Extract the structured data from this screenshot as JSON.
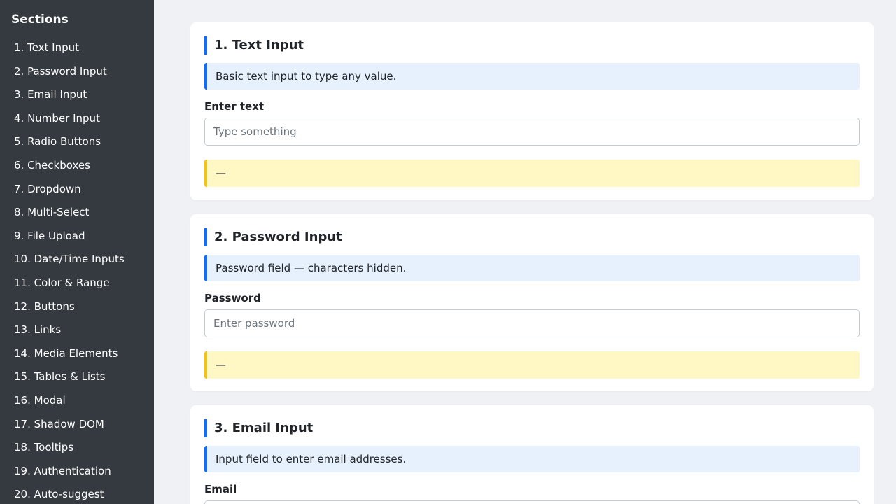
{
  "sidebar": {
    "title": "Sections",
    "items": [
      {
        "label": "1. Text Input"
      },
      {
        "label": "2. Password Input"
      },
      {
        "label": "3. Email Input"
      },
      {
        "label": "4. Number Input"
      },
      {
        "label": "5. Radio Buttons"
      },
      {
        "label": "6. Checkboxes"
      },
      {
        "label": "7. Dropdown"
      },
      {
        "label": "8. Multi-Select"
      },
      {
        "label": "9. File Upload"
      },
      {
        "label": "10. Date/Time Inputs"
      },
      {
        "label": "11. Color & Range"
      },
      {
        "label": "12. Buttons"
      },
      {
        "label": "13. Links"
      },
      {
        "label": "14. Media Elements"
      },
      {
        "label": "15. Tables & Lists"
      },
      {
        "label": "16. Modal"
      },
      {
        "label": "17. Shadow DOM"
      },
      {
        "label": "18. Tooltips"
      },
      {
        "label": "19. Authentication"
      },
      {
        "label": "20. Auto-suggest"
      }
    ]
  },
  "sections": {
    "text_input": {
      "title": "1. Text Input",
      "description": "Basic text input to type any value.",
      "label": "Enter text",
      "placeholder": "Type something",
      "value": "",
      "output": "—"
    },
    "password_input": {
      "title": "2. Password Input",
      "description": "Password field — characters hidden.",
      "label": "Password",
      "placeholder": "Enter password",
      "value": "",
      "output": "—"
    },
    "email_input": {
      "title": "3. Email Input",
      "description": "Input field to enter email addresses.",
      "label": "Email",
      "placeholder": "",
      "value": ""
    }
  },
  "colors": {
    "sidebar_bg": "#343a40",
    "page_bg": "#f0f1f4",
    "accent": "#0d6efd",
    "info_bg": "#e7f1fe",
    "output_bg": "#fff7c4",
    "output_border": "#f1c40f"
  }
}
